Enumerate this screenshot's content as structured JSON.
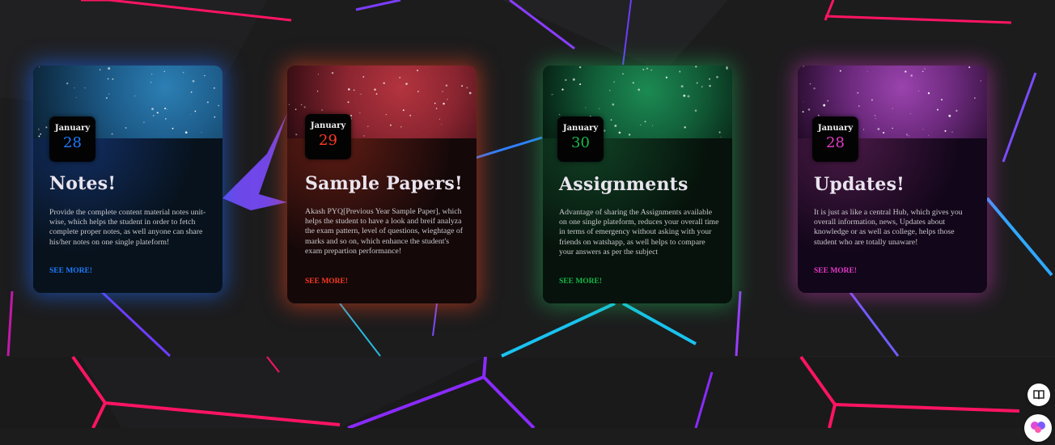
{
  "cards": [
    {
      "month": "January",
      "day": "28",
      "title": "Notes!",
      "description": "Provide the complete content material notes unit-wise, which helps the student in order to fetch complete proper notes, as well anyone can share his/her notes on one single plateform!",
      "link": "SEE MORE!",
      "accent": "#1e7bff",
      "art_color": "#1d5c8a"
    },
    {
      "month": "January",
      "day": "29",
      "title": "Sample Papers!",
      "description": "Akash PYQ[Previous Year Sample Paper], which helps the student to have a look and breif analyza the exam pattern, level of questions, wieghtage of marks and so on, which enhance the student's exam prepartion performance!",
      "link": "SEE MORE!",
      "accent": "#ff3a22",
      "art_color": "#8a2530"
    },
    {
      "month": "January",
      "day": "30",
      "title": "Assignments",
      "description": "Advantage of sharing the Assignments available on one single plateform, reduces your overall time in terms of emergency without asking with your friends on watshapp, as well helps to compare your answers as per the subject",
      "link": "SEE MORE!",
      "accent": "#16b84a",
      "art_color": "#12603a"
    },
    {
      "month": "January",
      "day": "28",
      "title": "Updates!",
      "description": "It is just as like a central Hub, which gives you overall information, news, Updates about knowledge or as well as college, helps those student who are totally unaware!",
      "link": "SEE MORE!",
      "accent": "#e43bc8",
      "art_color": "#6d2a7e"
    }
  ],
  "floating": {
    "book_icon": "book-icon",
    "brain_icon": "brain-icon"
  }
}
